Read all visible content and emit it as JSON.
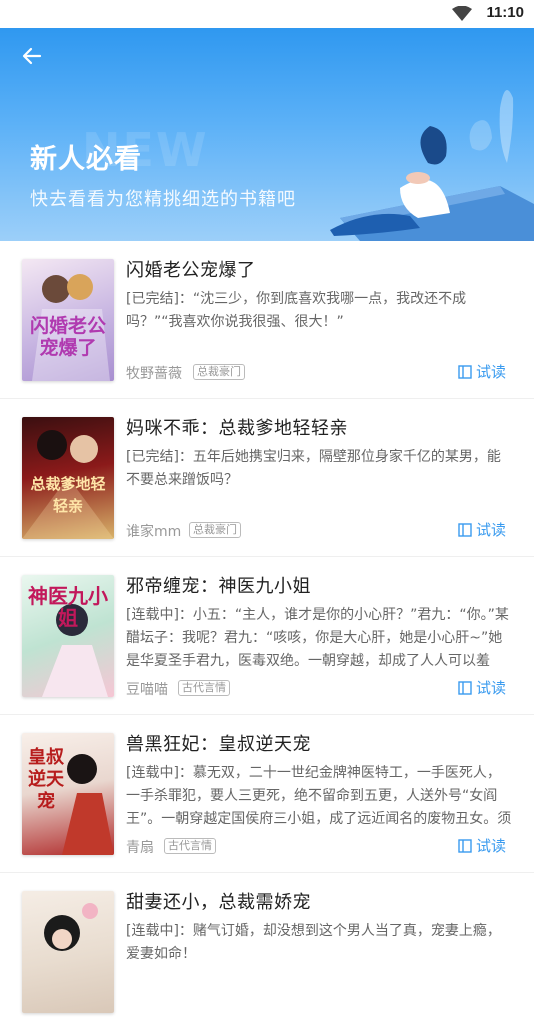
{
  "status_bar": {
    "time": "11:10",
    "wifi_icon": "wifi-icon"
  },
  "header": {
    "back_icon": "back-arrow-icon",
    "watermark": "NEW",
    "title": "新人必看",
    "subtitle": "快去看看为您精挑细选的书籍吧"
  },
  "books": [
    {
      "title": "闪婚老公宠爆了",
      "desc": "[已完结]：“沈三少，你到底喜欢我哪一点，我改还不成吗？”“我喜欢你说我很强、很大！”",
      "author": "牧野蔷薇",
      "tag": "总裁豪门",
      "read_label": "试读",
      "cover_text": "闪婚老公宠爆了",
      "cover_color": "#c8b6e2"
    },
    {
      "title": "妈咪不乖：总裁爹地轻轻亲",
      "desc": "[已完结]：五年后她携宝归来，隔壁那位身家千亿的某男，能不要总来蹭饭吗？",
      "author": "谁家mm",
      "tag": "总裁豪门",
      "read_label": "试读",
      "cover_text": "总裁爹地轻轻亲",
      "cover_color": "#8b1a1a"
    },
    {
      "title": "邪帝缠宠：神医九小姐",
      "desc": "[连载中]：小五：“主人，谁才是你的小心肝？”君九：“你。”某醋坛子：我呢？君九：“咳咳，你是大心肝，她是小心肝~”她是华夏圣手君九，医毒双绝。一朝穿越，却成了人人可以羞辱...",
      "author": "豆喵喵",
      "tag": "古代言情",
      "read_label": "试读",
      "cover_text": "神医九小姐",
      "cover_color": "#bfe3d2"
    },
    {
      "title": "兽黑狂妃：皇叔逆天宠",
      "desc": "[连载中]：慕无双，二十一世纪金牌神医特工，一手医死人，一手杀罪犯，要人三更死，绝不留命到五更，人送外号“女阎王”。一朝穿越定国侯府三小姐，成了远近闻名的废物丑女。须不...",
      "author": "青扇",
      "tag": "古代言情",
      "read_label": "试读",
      "cover_text": "皇叔逆天宠",
      "cover_color": "#e9d7cf"
    },
    {
      "title": "甜妻还小，总裁需娇宠",
      "desc": "[连载中]：赌气订婚，却没想到这个男人当了真，宠妻上瘾，爱妻如命！",
      "author": "",
      "tag": "",
      "read_label": "",
      "cover_text": "",
      "cover_color": "#e8dccf"
    }
  ],
  "colors": {
    "accent": "#3a9bef",
    "header_blue": "#2f98f0"
  }
}
